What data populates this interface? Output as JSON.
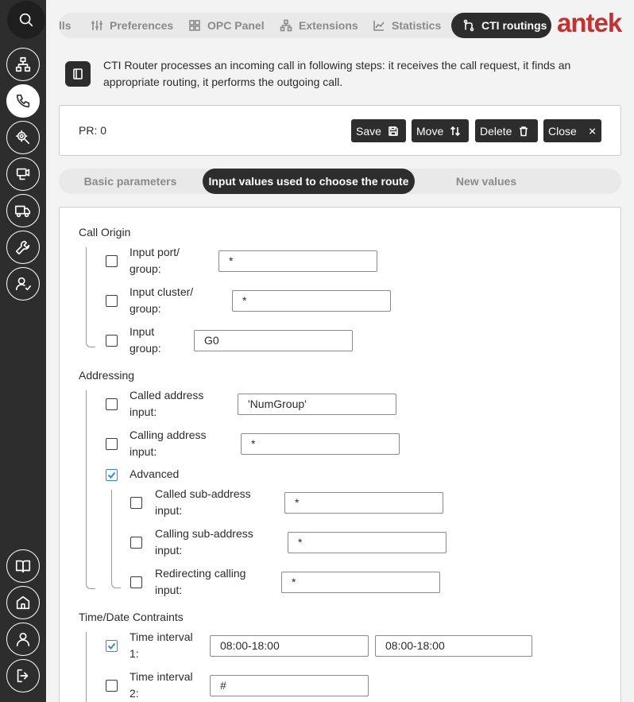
{
  "nav": {
    "items": [
      {
        "label": "lls"
      },
      {
        "label": "Preferences",
        "icon": "sliders-icon"
      },
      {
        "label": "OPC Panel",
        "icon": "grid-icon"
      },
      {
        "label": "Extensions",
        "icon": "extensions-icon"
      },
      {
        "label": "Statistics",
        "icon": "chart-icon"
      },
      {
        "label": "CTI routings",
        "icon": "routing-icon",
        "active": true
      }
    ],
    "logo": "antek"
  },
  "info": {
    "text": "CTI Router processes an incoming call in following steps: it receives the call request, it finds an appropriate routing, it performs the outgoing call."
  },
  "toolbar": {
    "pr_label": "PR: 0",
    "save": "Save",
    "move": "Move",
    "delete": "Delete",
    "close": "Close"
  },
  "tabs": [
    {
      "label": "Basic parameters"
    },
    {
      "label": "Input values used to choose the route",
      "active": true
    },
    {
      "label": "New values"
    }
  ],
  "form": {
    "call_origin": {
      "title": "Call Origin",
      "input_port": {
        "label1": "Input port/",
        "label2": "group:",
        "value": "*",
        "checked": false
      },
      "input_cluster": {
        "label1": "Input cluster/",
        "label2": "group:",
        "value": "*",
        "checked": false
      },
      "input_group": {
        "label1": "Input",
        "label2": "group:",
        "value": "G0",
        "checked": false
      }
    },
    "addressing": {
      "title": "Addressing",
      "called": {
        "label1": "Called address",
        "label2": "input:",
        "value": "'NumGroup'",
        "checked": false
      },
      "calling": {
        "label1": "Calling address",
        "label2": "input:",
        "value": "*",
        "checked": false
      },
      "advanced": {
        "label": "Advanced",
        "checked": true
      },
      "called_sub": {
        "label1": "Called sub-address",
        "label2": "input:",
        "value": "*",
        "checked": false
      },
      "calling_sub": {
        "label1": "Calling sub-address",
        "label2": "input:",
        "value": "*",
        "checked": false
      },
      "redirecting": {
        "label1": "Redirecting calling",
        "label2": "input:",
        "value": "*",
        "checked": false
      }
    },
    "time": {
      "title": "Time/Date Contraints",
      "interval1": {
        "label1": "Time interval",
        "label2": "1:",
        "value_a": "08:00-18:00",
        "value_b": "08:00-18:00",
        "checked": true
      },
      "interval2": {
        "label1": "Time interval",
        "label2": "2:",
        "value": "#",
        "checked": false
      }
    }
  },
  "colors": {
    "sidebar": "#2d2d2d",
    "accent_check": "#2a8fd8",
    "logo": "#c9302c"
  }
}
